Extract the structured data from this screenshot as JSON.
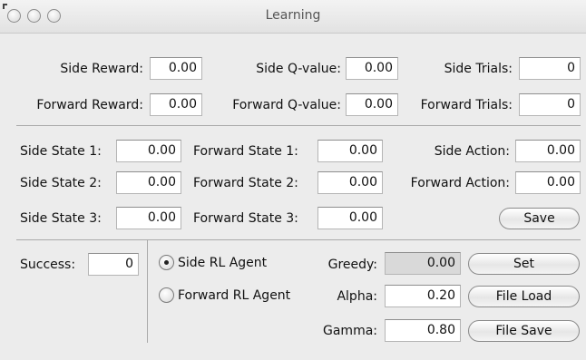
{
  "window": {
    "title": "Learning"
  },
  "row1": {
    "side_reward_label": "Side Reward:",
    "side_reward": "0.00",
    "side_q_label": "Side Q-value:",
    "side_q": "0.00",
    "side_trials_label": "Side Trials:",
    "side_trials": "0"
  },
  "row2": {
    "forward_reward_label": "Forward Reward:",
    "forward_reward": "0.00",
    "forward_q_label": "Forward Q-value:",
    "forward_q": "0.00",
    "forward_trials_label": "Forward Trials:",
    "forward_trials": "0"
  },
  "states": {
    "side_state_1_label": "Side State 1:",
    "side_state_1": "0.00",
    "forward_state_1_label": "Forward State 1:",
    "forward_state_1": "0.00",
    "side_action_label": "Side Action:",
    "side_action": "0.00",
    "side_state_2_label": "Side State 2:",
    "side_state_2": "0.00",
    "forward_state_2_label": "Forward State 2:",
    "forward_state_2": "0.00",
    "forward_action_label": "Forward Action:",
    "forward_action": "0.00",
    "side_state_3_label": "Side State 3:",
    "side_state_3": "0.00",
    "forward_state_3_label": "Forward State 3:",
    "forward_state_3": "0.00",
    "save_label": "Save"
  },
  "bottom": {
    "success_label": "Success:",
    "success": "0",
    "side_agent_label": "Side RL Agent",
    "forward_agent_label": "Forward RL Agent",
    "selected_agent": "Side RL Agent",
    "greedy_label": "Greedy:",
    "greedy": "0.00",
    "alpha_label": "Alpha:",
    "alpha": "0.20",
    "gamma_label": "Gamma:",
    "gamma": "0.80",
    "set_label": "Set",
    "file_load_label": "File Load",
    "file_save_label": "File Save"
  }
}
